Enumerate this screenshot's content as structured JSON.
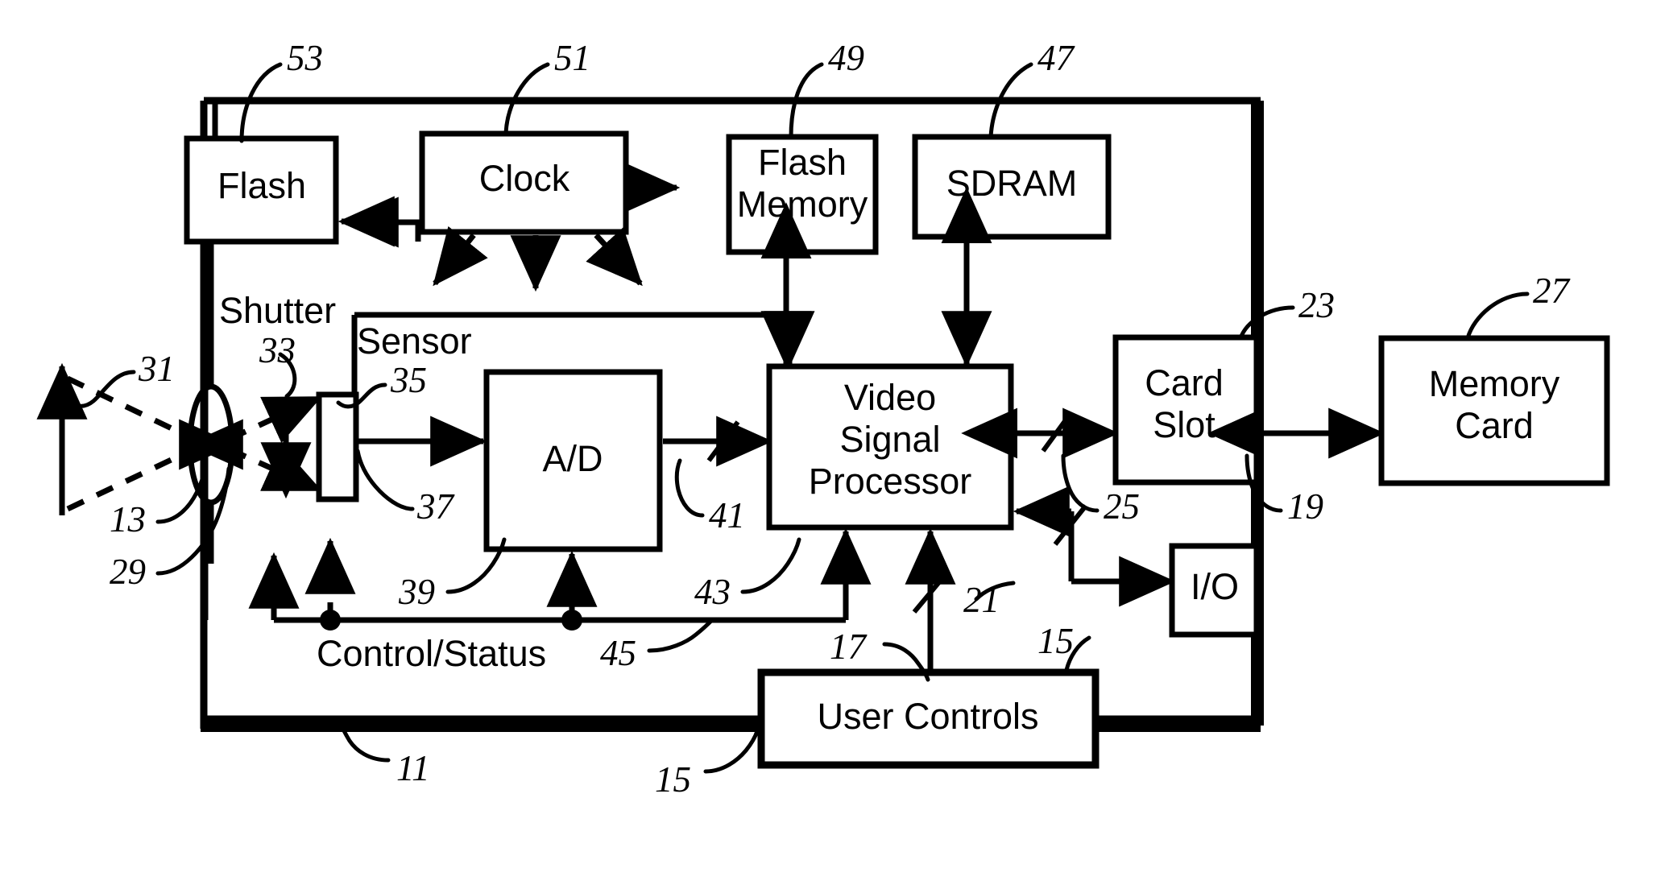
{
  "figure": {
    "type": "patent-block-diagram",
    "subject": "digital camera system block diagram",
    "background_color": "#ffffff",
    "line_color": "#000000"
  },
  "blocks": [
    {
      "id": "flash",
      "label": "Flash"
    },
    {
      "id": "clock",
      "label": "Clock"
    },
    {
      "id": "flashmem",
      "label_line1": "Flash",
      "label_line2": "Memory"
    },
    {
      "id": "sdram",
      "label": "SDRAM"
    },
    {
      "id": "ad",
      "label": "A/D"
    },
    {
      "id": "vsp",
      "label_line1": "Video",
      "label_line2": "Signal",
      "label_line3": "Processor"
    },
    {
      "id": "cardslot",
      "label_line1": "Card",
      "label_line2": "Slot"
    },
    {
      "id": "memcard",
      "label_line1": "Memory",
      "label_line2": "Card"
    },
    {
      "id": "io",
      "label": "I/O"
    },
    {
      "id": "usercontrols",
      "label": "User Controls"
    }
  ],
  "free_labels": {
    "shutter": "Shutter",
    "sensor": "Sensor",
    "control_status": "Control/Status"
  },
  "reference_numerals": [
    {
      "num": "53",
      "points_to": "camera-body-to-flash"
    },
    {
      "num": "51",
      "points_to": "clock"
    },
    {
      "num": "49",
      "points_to": "flash-memory"
    },
    {
      "num": "47",
      "points_to": "sdram"
    },
    {
      "num": "23",
      "points_to": "card-slot-interface"
    },
    {
      "num": "27",
      "points_to": "memory-card"
    },
    {
      "num": "31",
      "points_to": "optical-scene-rays"
    },
    {
      "num": "33",
      "points_to": "shutter"
    },
    {
      "num": "35",
      "points_to": "sensor"
    },
    {
      "num": "37",
      "points_to": "sensor-output"
    },
    {
      "num": "13",
      "points_to": "lens"
    },
    {
      "num": "29",
      "points_to": "lens-assembly"
    },
    {
      "num": "39",
      "points_to": "a-d-control"
    },
    {
      "num": "41",
      "points_to": "digital-image-bus"
    },
    {
      "num": "43",
      "points_to": "vsp-control"
    },
    {
      "num": "45",
      "points_to": "control-status-bus"
    },
    {
      "num": "25",
      "points_to": "card-slot-bus"
    },
    {
      "num": "19",
      "points_to": "io-port"
    },
    {
      "num": "21",
      "points_to": "user-controls-bus"
    },
    {
      "num": "17",
      "points_to": "user-controls-line"
    },
    {
      "num": "15",
      "points_to": "user-controls"
    },
    {
      "num": "11",
      "points_to": "camera"
    }
  ]
}
